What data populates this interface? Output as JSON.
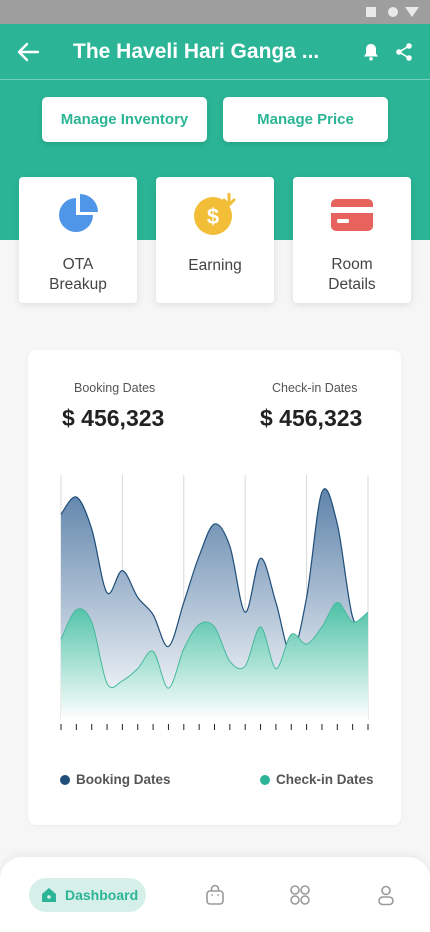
{
  "app": {
    "title": "The Haveli Hari Ganga ...",
    "accent": "#2bb596"
  },
  "header": {
    "back_icon": "arrow-left-icon",
    "notification_icon": "bell-icon",
    "share_icon": "share-icon"
  },
  "actions": {
    "manage_inventory": "Manage Inventory",
    "manage_price": "Manage Price"
  },
  "tiles": [
    {
      "label": "OTA\nBreakup",
      "icon": "pie-chart-icon",
      "color": "#4f95e8"
    },
    {
      "label": "Earning",
      "icon": "coin-download-icon",
      "color": "#f2be37"
    },
    {
      "label": "Room\nDetails",
      "icon": "credit-card-icon",
      "color": "#e8625e"
    }
  ],
  "stats": {
    "booking_label": "Booking Dates",
    "booking_value": "$ 456,323",
    "checkin_label": "Check-in Dates",
    "checkin_value": "$ 456,323"
  },
  "chart_data": {
    "type": "area",
    "x": [
      0,
      1,
      2,
      3,
      4,
      5,
      6,
      7,
      8,
      9,
      10,
      11,
      12,
      13,
      14,
      15,
      16,
      17,
      18,
      19,
      20
    ],
    "series": [
      {
        "name": "Booking Dates",
        "color": "#1f4e79",
        "values": [
          84,
          91,
          78,
          52,
          61,
          50,
          43,
          30,
          48,
          67,
          80,
          71,
          44,
          66,
          48,
          27,
          50,
          93,
          80,
          42,
          37
        ]
      },
      {
        "name": "Check-in Dates",
        "color": "#2bb596",
        "values": [
          33,
          45,
          40,
          15,
          16,
          21,
          28,
          13,
          29,
          39,
          38,
          24,
          22,
          38,
          21,
          35,
          31,
          38,
          48,
          40,
          44
        ]
      }
    ],
    "ylim": [
      0,
      100
    ],
    "legend_position": "bottom",
    "grid": "vertical"
  },
  "legend": {
    "booking": "Booking Dates",
    "checkin": "Check-in Dates"
  },
  "nav": {
    "dashboard": "Dashboard",
    "items": [
      "home-icon",
      "bag-icon",
      "grid-icon",
      "user-icon"
    ]
  }
}
